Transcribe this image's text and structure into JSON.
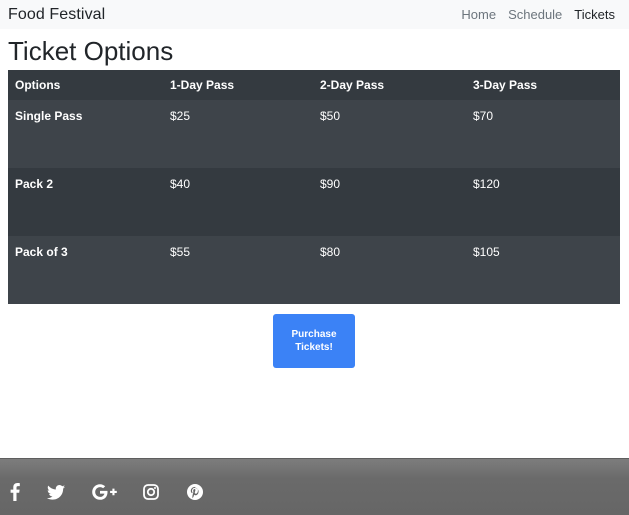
{
  "navbar": {
    "brand": "Food Festival",
    "links": [
      {
        "label": "Home"
      },
      {
        "label": "Schedule"
      },
      {
        "label": "Tickets"
      }
    ]
  },
  "main": {
    "title": "Ticket Options",
    "table": {
      "headers": [
        "Options",
        "1-Day Pass",
        "2-Day Pass",
        "3-Day Pass"
      ],
      "rows": [
        {
          "option": "Single Pass",
          "day1": "$25",
          "day2": "$50",
          "day3": "$70"
        },
        {
          "option": "Pack 2",
          "day1": "$40",
          "day2": "$90",
          "day3": "$120"
        },
        {
          "option": "Pack of 3",
          "day1": "$55",
          "day2": "$80",
          "day3": "$105"
        }
      ]
    },
    "purchase_label": "Purchase Tickets!"
  },
  "footer": {
    "social_icons": [
      "facebook-icon",
      "twitter-icon",
      "google-plus-icon",
      "instagram-icon",
      "pinterest-icon"
    ]
  },
  "colors": {
    "navbar_bg": "#f8f9fa",
    "table_dark": "#343a40",
    "table_row_light": "#3e444a",
    "button_blue": "#3b82f6",
    "footer_bg": "#666666"
  }
}
